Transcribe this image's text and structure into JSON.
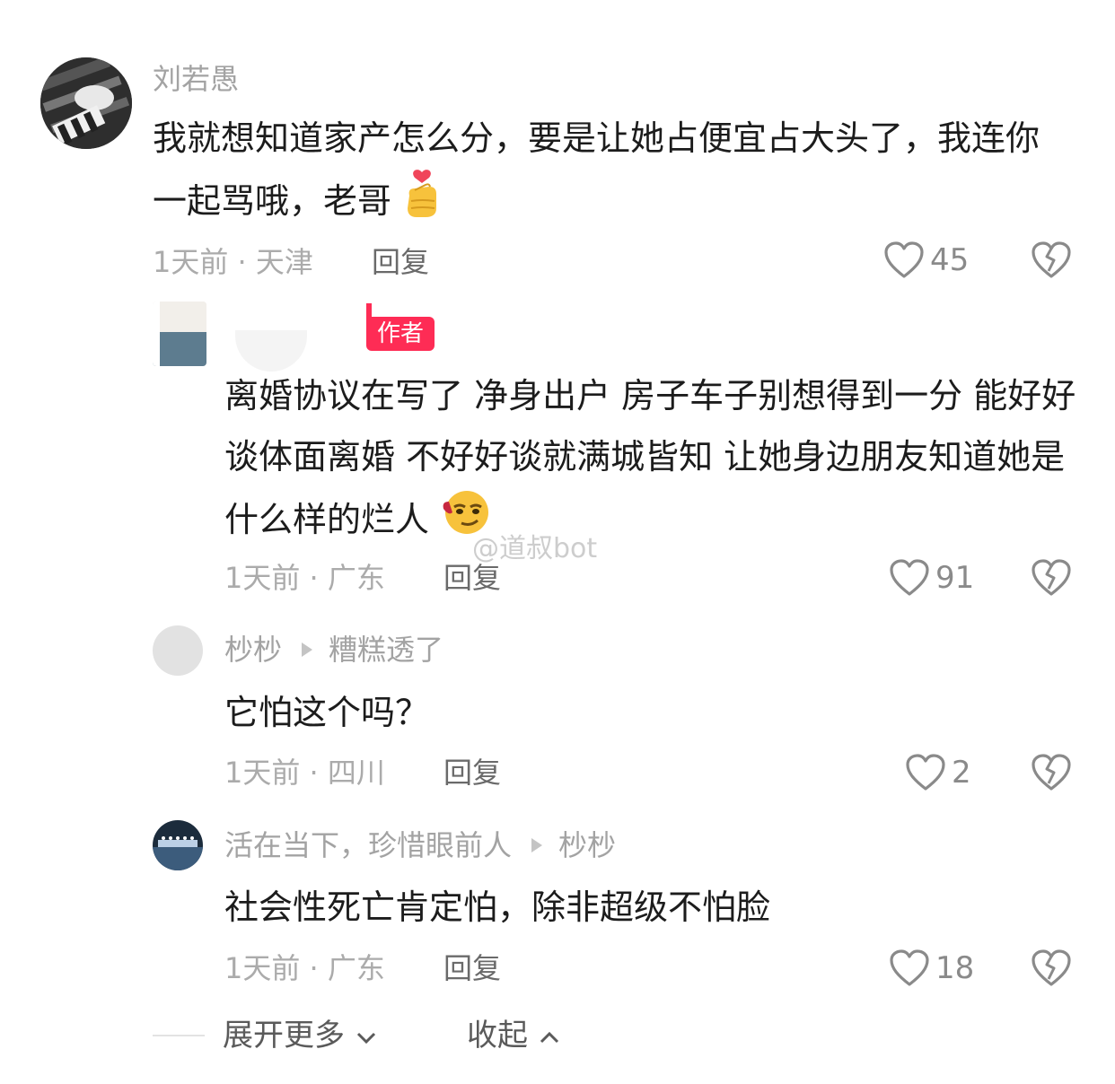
{
  "comments": [
    {
      "username": "刘若愚",
      "text": "我就想知道家产怎么分，要是让她占便宜占大头了，我连你一起骂哦，老哥",
      "meta": "1天前 · 天津",
      "reply_label": "回复",
      "likes": "45"
    },
    {
      "badge": "作者",
      "text": "离婚协议在写了 净身出户 房子车子别想得到一分 能好好谈体面离婚 不好好谈就满城皆知 让她身边朋友知道她是什么样的烂人",
      "meta": "1天前 · 广东",
      "reply_label": "回复",
      "likes": "91"
    },
    {
      "username": "杪杪",
      "reply_to": "糟糕透了",
      "text": "它怕这个吗？",
      "meta": "1天前 · 四川",
      "reply_label": "回复",
      "likes": "2"
    },
    {
      "username": "活在当下，珍惜眼前人",
      "reply_to": "杪杪",
      "text": "社会性死亡肯定怕，除非超级不怕脸",
      "meta": "1天前 · 广东",
      "reply_label": "回复",
      "likes": "18"
    }
  ],
  "footer": {
    "expand_label": "展开更多",
    "collapse_label": "收起"
  },
  "watermark": "@道叔bot",
  "colors": {
    "author_badge": "#fe2c55",
    "secondary_text": "#a3a3a3",
    "primary_text": "#1c1c1c"
  }
}
